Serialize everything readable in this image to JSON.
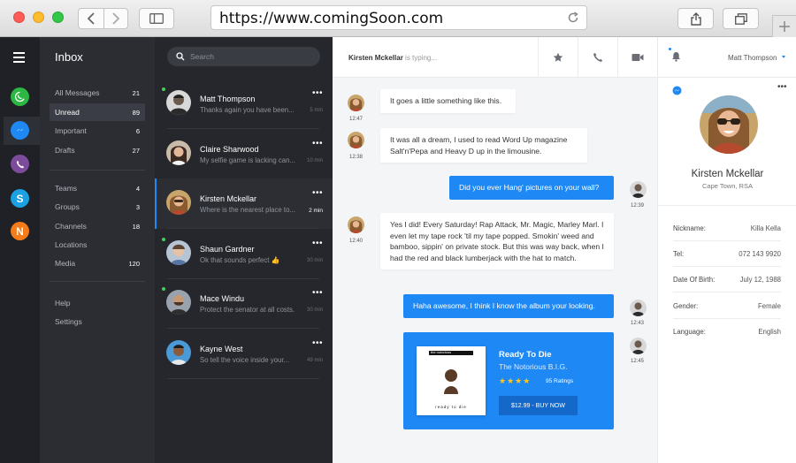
{
  "browser": {
    "url": "https://www.comingSoon.com"
  },
  "apps": [
    {
      "name": "whatsapp",
      "color": "#2cb742"
    },
    {
      "name": "messenger",
      "color": "#1e88f5"
    },
    {
      "name": "viber",
      "color": "#7d4b9b"
    },
    {
      "name": "skype",
      "color": "#1ba0e2"
    },
    {
      "name": "n-app",
      "color": "#f57c1b",
      "letter": "N"
    }
  ],
  "folders": {
    "title": "Inbox",
    "items": [
      {
        "label": "All Messages",
        "count": "21"
      },
      {
        "label": "Unread",
        "count": "89"
      },
      {
        "label": "Important",
        "count": "6"
      },
      {
        "label": "Drafts",
        "count": "27"
      },
      {
        "label": "Teams",
        "count": "4"
      },
      {
        "label": "Groups",
        "count": "3"
      },
      {
        "label": "Channels",
        "count": "18"
      },
      {
        "label": "Locations",
        "count": ""
      },
      {
        "label": "Media",
        "count": "120"
      },
      {
        "label": "Help",
        "count": ""
      },
      {
        "label": "Settings",
        "count": ""
      }
    ]
  },
  "search": {
    "placeholder": "Search"
  },
  "conversations": [
    {
      "name": "Matt Thompson",
      "preview": "Thanks again you have been...",
      "time": "5 min",
      "online": true
    },
    {
      "name": "Claire Sharwood",
      "preview": "My selfie game is lacking can...",
      "time": "10 min",
      "online": false
    },
    {
      "name": "Kirsten Mckellar",
      "preview": "Where is the nearest place to...",
      "time": "2 min",
      "online": false
    },
    {
      "name": "Shaun Gardner",
      "preview": "Ok that sounds perfect 👍",
      "time": "30 min",
      "online": true
    },
    {
      "name": "Mace Windu",
      "preview": "Protect the senator at all costs.",
      "time": "30 min",
      "online": true
    },
    {
      "name": "Kayne West",
      "preview": "So tell the voice inside your...",
      "time": "49 min",
      "online": false
    }
  ],
  "chat": {
    "typing_name": "Kirsten Mckellar",
    "typing_suffix": " is typing...",
    "messages": [
      {
        "text": "It goes a little something like this.",
        "time": "12:47"
      },
      {
        "text": "It was all a dream, I used to read Word Up magazine Salt'n'Pepa and Heavy D up in the limousine.",
        "time": "12:38"
      },
      {
        "text": "Did you ever Hang' pictures on your wall?",
        "time": "12:39"
      },
      {
        "text": "Yes I did! Every Saturday! Rap Attack, Mr. Magic, Marley Marl. I even let my tape rock 'til my tape popped. Smokin' weed and bamboo, sippin' on private stock.  But this was way back, when I had the red and black lumberjack with the hat to match.",
        "time": "12:40"
      },
      {
        "text": "Haha awesome,  I think I know the album your looking.",
        "time": "12:43"
      },
      {
        "time": "12:45"
      }
    ],
    "album": {
      "cover_title": "the notorious",
      "cover_footer": "ready to die",
      "title": "Ready To Die",
      "artist": "The Notorious B.I.G.",
      "stars": "★★★★",
      "rating_count": "95 Ratings",
      "price": "$12.99",
      "buy_label": "BUY NOW"
    }
  },
  "profile": {
    "current_user": "Matt Thompson",
    "name": "Kirsten Mckellar",
    "location": "Cape Town, RSA",
    "details": [
      {
        "label": "Nickname:",
        "value": "Killa Kella"
      },
      {
        "label": "Tel:",
        "value": "072 143 9920"
      },
      {
        "label": "Date Of Birth:",
        "value": "July 12, 1988"
      },
      {
        "label": "Gender:",
        "value": "Female"
      },
      {
        "label": "Language:",
        "value": "English"
      }
    ]
  },
  "colors": {
    "accent": "#1e88f5",
    "online": "#3fd15a",
    "star": "#ffc81e"
  }
}
